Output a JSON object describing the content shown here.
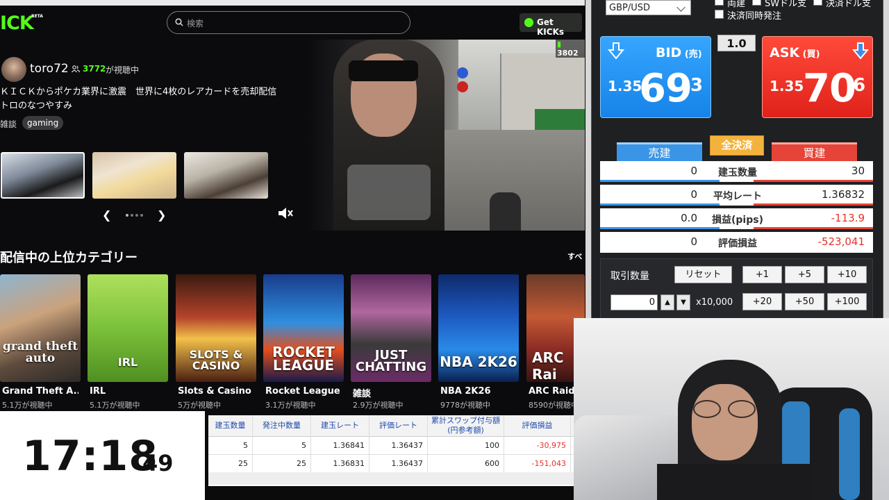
{
  "kick": {
    "logo": "ICK",
    "beta": "BETA",
    "search_placeholder": "検索",
    "get_kicks": "Get KICKs",
    "streamer": {
      "name": "toro72",
      "viewer_count": "3772",
      "viewer_suffix": "が視聴中",
      "title": "ＫＩＣＫからポケカ業界に激震　世界に4枚のレアカードを売却配信　トロのなつやすみ",
      "category": "雑談",
      "tag": "gaming"
    },
    "video_viewers": "3802",
    "categories_heading": "配信中の上位カテゴリー",
    "see_all": "すべ",
    "categories": [
      {
        "name": "Grand Theft A...",
        "viewers": "5.1万が視聴中",
        "cover": "grand theft auto"
      },
      {
        "name": "IRL",
        "viewers": "5.1万が視聴中",
        "cover": "IRL"
      },
      {
        "name": "Slots & Casino",
        "viewers": "5万が視聴中",
        "cover": "SLOTS & CASINO"
      },
      {
        "name": "Rocket League",
        "viewers": "3.1万が視聴中",
        "cover": "ROCKET LEAGUE"
      },
      {
        "name": "雑談",
        "viewers": "2.9万が視聴中",
        "cover": "JUST CHATTING"
      },
      {
        "name": "NBA 2K26",
        "viewers": "9778が視聴中",
        "cover": "NBA 2K26"
      },
      {
        "name": "ARC Raide",
        "viewers": "8590が視聴中",
        "cover": "ARC Rai"
      }
    ]
  },
  "fx": {
    "pair": "GBP/USD",
    "checkboxes": [
      "両建",
      "SWドル支",
      "決済ドル支",
      "決済同時発注"
    ],
    "bid": {
      "label": "BID",
      "label_jp": "(売)",
      "big": "1.35",
      "main": "69",
      "frac": "3"
    },
    "ask": {
      "label": "ASK",
      "label_jp": "(買)",
      "big": "1.35",
      "main": "70",
      "frac": "6"
    },
    "spread": "1.0",
    "tab_sell": "売建",
    "tab_close": "全決済",
    "tab_buy": "買建",
    "rows": [
      {
        "left": "0",
        "label": "建玉数量",
        "right": "30",
        "neg": false
      },
      {
        "left": "0",
        "label": "平均レート",
        "right": "1.36832",
        "neg": false
      },
      {
        "left": "0.0",
        "label": "損益(pips)",
        "right": "-113.9",
        "neg": true
      },
      {
        "left": "0",
        "label": "評価損益",
        "right": "-523,041",
        "neg": true
      }
    ],
    "lot_label": "取引数量",
    "reset": "リセット",
    "inc_row1": [
      "+1",
      "+5",
      "+10"
    ],
    "inc_row2": [
      "+20",
      "+50",
      "+100"
    ],
    "qty": "0",
    "step_up": "▲",
    "step_down": "▼",
    "unit": "x10,000"
  },
  "clock": {
    "main": "17:18",
    "sec": "49"
  },
  "positions": {
    "headers": [
      "建玉数量",
      "発注中数量",
      "建玉レート",
      "評価レート",
      "累計スワップ付与額\n(円参考額)",
      "評価損益",
      "建"
    ],
    "rows": [
      [
        "5",
        "5",
        "1.36841",
        "1.36437",
        "100",
        "-30,975",
        "("
      ],
      [
        "25",
        "25",
        "1.36831",
        "1.36437",
        "600",
        "-151,043",
        "("
      ]
    ]
  },
  "colors": {
    "kick_green": "#53fc18",
    "bid_blue": "#1683e8",
    "ask_red": "#e0221a",
    "loss_red": "#e8302a"
  }
}
